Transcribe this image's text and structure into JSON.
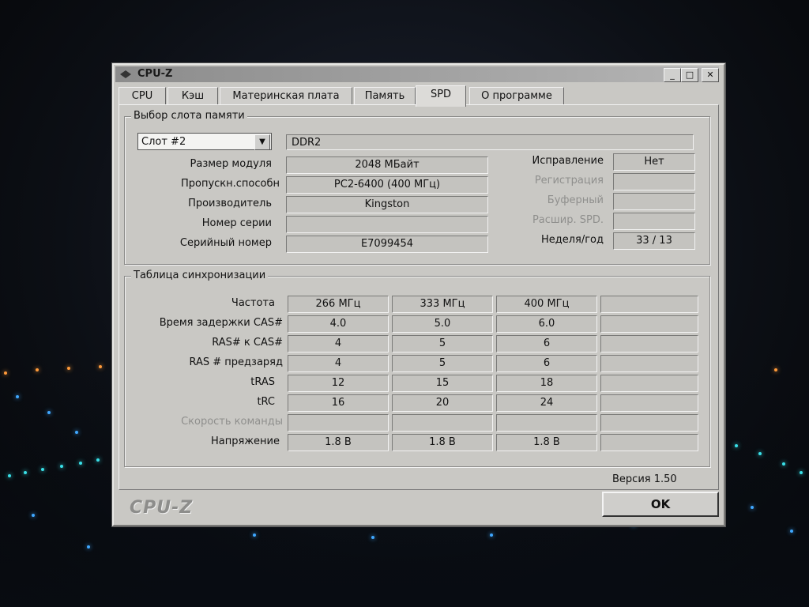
{
  "window": {
    "title": "CPU-Z"
  },
  "titlebar_buttons": {
    "minimize": "_",
    "maximize": "□",
    "close": "✕"
  },
  "tabs": [
    {
      "label": "CPU"
    },
    {
      "label": "Кэш"
    },
    {
      "label": "Материнская плата"
    },
    {
      "label": "Память"
    },
    {
      "label": "SPD"
    },
    {
      "label": "О программе"
    }
  ],
  "slot_group": {
    "legend": "Выбор слота памяти",
    "selected_slot": "Слот #2",
    "memory_type": "DDR2",
    "rows": [
      {
        "label": "Размер модуля",
        "value": "2048 МБайт"
      },
      {
        "label": "Пропускн.способн",
        "value": "PC2-6400 (400 МГц)"
      },
      {
        "label": "Производитель",
        "value": "Kingston"
      },
      {
        "label": "Номер серии",
        "value": ""
      },
      {
        "label": "Серийный номер",
        "value": "E7099454"
      }
    ],
    "right_rows": [
      {
        "label": "Исправление",
        "value": "Нет"
      },
      {
        "label": "Регистрация",
        "value": ""
      },
      {
        "label": "Буферный",
        "value": ""
      },
      {
        "label": "Расшир. SPD.",
        "value": ""
      },
      {
        "label": "Неделя/год",
        "value": "33 / 13"
      }
    ]
  },
  "timing_group": {
    "legend": "Таблица синхронизации",
    "rows": [
      {
        "label": "Частота",
        "values": [
          "266 МГц",
          "333 МГц",
          "400 МГц",
          ""
        ]
      },
      {
        "label": "Время задержки CAS#",
        "values": [
          "4.0",
          "5.0",
          "6.0",
          ""
        ]
      },
      {
        "label": "RAS# к CAS#",
        "values": [
          "4",
          "5",
          "6",
          ""
        ]
      },
      {
        "label": "RAS # предзаряд",
        "values": [
          "4",
          "5",
          "6",
          ""
        ]
      },
      {
        "label": "tRAS",
        "values": [
          "12",
          "15",
          "18",
          ""
        ]
      },
      {
        "label": "tRC",
        "values": [
          "16",
          "20",
          "24",
          ""
        ]
      },
      {
        "label": "Скорость команды",
        "values": [
          "",
          "",
          "",
          ""
        ]
      },
      {
        "label": "Напряжение",
        "values": [
          "1.8 В",
          "1.8 В",
          "1.8 В",
          ""
        ]
      }
    ]
  },
  "footer": {
    "version": "Версия 1.50",
    "brand": "CPU-Z",
    "ok_label": "OK"
  }
}
